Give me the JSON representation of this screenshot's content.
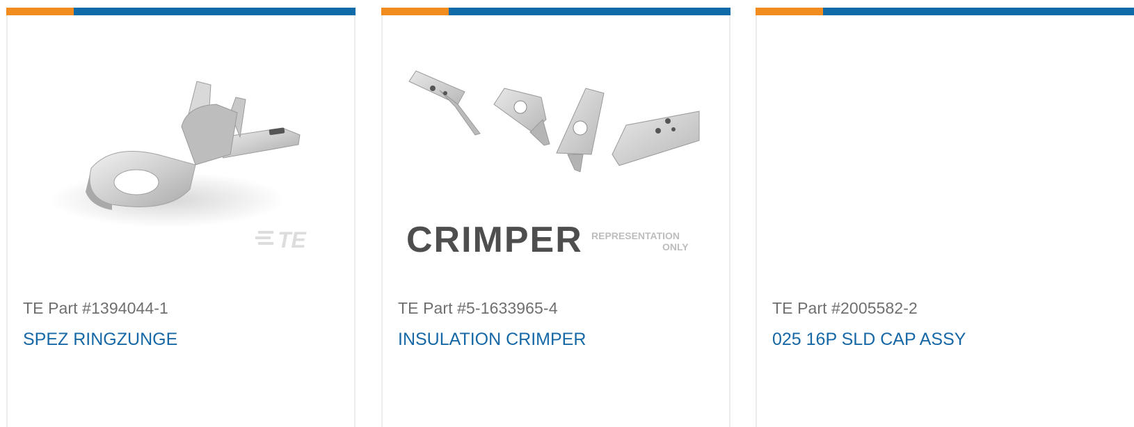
{
  "cards": [
    {
      "part_number": "TE Part #1394044-1",
      "name": "SPEZ RINGZUNGE",
      "watermark": "TE",
      "image": "ring-tongue-terminal"
    },
    {
      "part_number": "TE Part #5-1633965-4",
      "name": "INSULATION CRIMPER",
      "banner": "CRIMPER",
      "representation_line1": "REPRESENTATION",
      "representation_line2": "ONLY",
      "image": "insulation-crimper-dies"
    },
    {
      "part_number": "TE Part #2005582-2",
      "name": "025 16P SLD CAP ASSY",
      "image": ""
    }
  ],
  "colors": {
    "accent_orange": "#f28c1e",
    "brand_blue": "#0e6aa8",
    "link_blue": "#1768a6",
    "part_gray": "#6f6f6f"
  }
}
